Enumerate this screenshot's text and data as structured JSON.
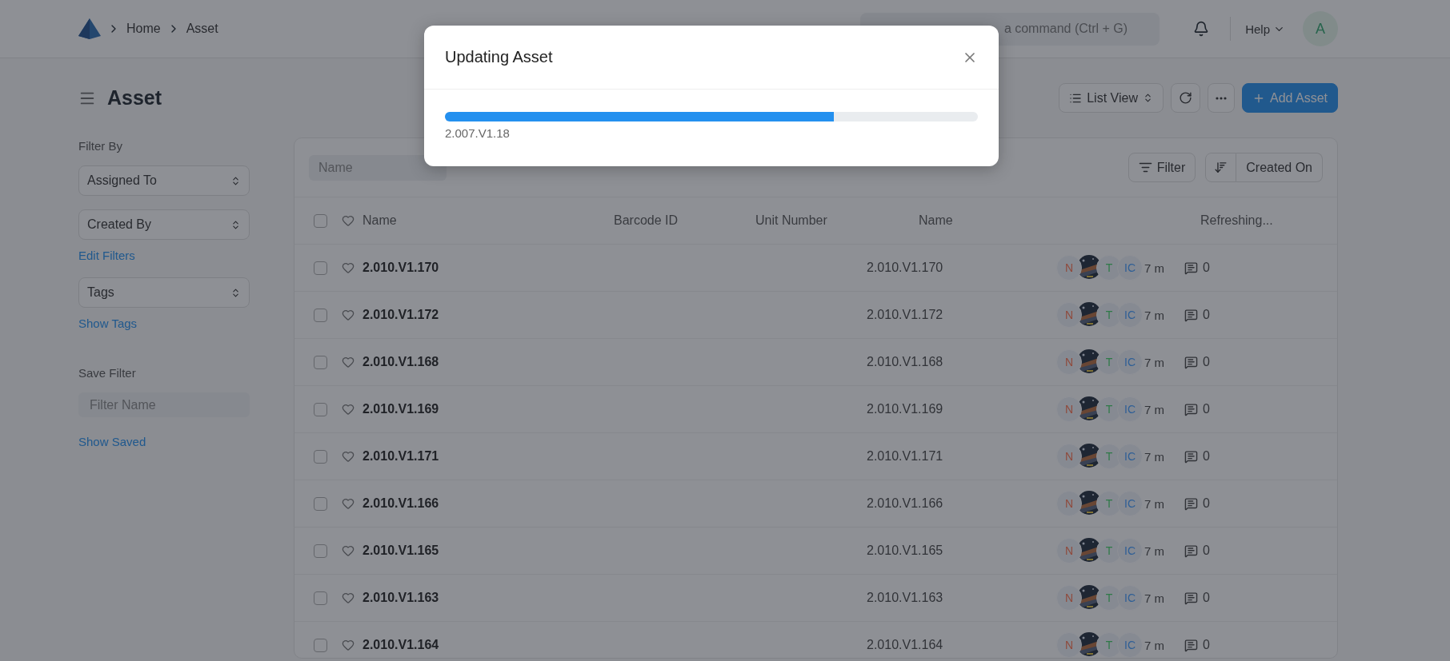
{
  "navbar": {
    "breadcrumbs": [
      "Home",
      "Asset"
    ],
    "search": {
      "placeholder": "a command (Ctrl + G)"
    },
    "help": "Help",
    "avatar": "A"
  },
  "page": {
    "title": "Asset",
    "view": "List View",
    "add": "Add Asset"
  },
  "sidebar": {
    "filter_heading": "Filter By",
    "filters": [
      "Assigned To",
      "Created By"
    ],
    "edit_link": "Edit Filters",
    "tags": "Tags",
    "tags_link": "Show Tags",
    "save_heading": "Save Filter",
    "save_field": {
      "placeholder": "Filter Name"
    },
    "saved_link": "Show Saved"
  },
  "filter_bar": {
    "name": {
      "placeholder": "Name"
    },
    "filter": "Filter",
    "sort": "Created On"
  },
  "table": {
    "select_all": {
      "checked": false
    },
    "columns": [
      "Name",
      "Barcode ID",
      "Unit Number",
      "Name",
      "Refreshing..."
    ],
    "rows": [
      {
        "checked": false,
        "name": "2.010.V1.170",
        "column_4": "2.010.V1.170",
        "assignees": [
          {
            "kind": "initials",
            "label": "N",
            "color": "#8f4a3c"
          },
          {
            "kind": "picture"
          },
          {
            "kind": "initials",
            "label": "T",
            "color": "#2f7a48"
          },
          {
            "kind": "initials",
            "label": "IC",
            "color": "#2f5f96"
          }
        ],
        "time": "7 m",
        "comments": "0"
      },
      {
        "checked": false,
        "name": "2.010.V1.172",
        "column_4": "2.010.V1.172",
        "assignees": [
          {
            "kind": "initials",
            "label": "N",
            "color": "#8f4a3c"
          },
          {
            "kind": "picture"
          },
          {
            "kind": "initials",
            "label": "T",
            "color": "#2f7a48"
          },
          {
            "kind": "initials",
            "label": "IC",
            "color": "#2f5f96"
          }
        ],
        "time": "7 m",
        "comments": "0"
      },
      {
        "checked": false,
        "name": "2.010.V1.168",
        "column_4": "2.010.V1.168",
        "assignees": [
          {
            "kind": "initials",
            "label": "N",
            "color": "#8f4a3c"
          },
          {
            "kind": "picture"
          },
          {
            "kind": "initials",
            "label": "T",
            "color": "#2f7a48"
          },
          {
            "kind": "initials",
            "label": "IC",
            "color": "#2f5f96"
          }
        ],
        "time": "7 m",
        "comments": "0"
      },
      {
        "checked": false,
        "name": "2.010.V1.169",
        "column_4": "2.010.V1.169",
        "assignees": [
          {
            "kind": "initials",
            "label": "N",
            "color": "#8f4a3c"
          },
          {
            "kind": "picture"
          },
          {
            "kind": "initials",
            "label": "T",
            "color": "#2f7a48"
          },
          {
            "kind": "initials",
            "label": "IC",
            "color": "#2f5f96"
          }
        ],
        "time": "7 m",
        "comments": "0"
      },
      {
        "checked": false,
        "name": "2.010.V1.171",
        "column_4": "2.010.V1.171",
        "assignees": [
          {
            "kind": "initials",
            "label": "N",
            "color": "#8f4a3c"
          },
          {
            "kind": "picture"
          },
          {
            "kind": "initials",
            "label": "T",
            "color": "#2f7a48"
          },
          {
            "kind": "initials",
            "label": "IC",
            "color": "#2f5f96"
          }
        ],
        "time": "7 m",
        "comments": "0"
      },
      {
        "checked": false,
        "name": "2.010.V1.166",
        "column_4": "2.010.V1.166",
        "assignees": [
          {
            "kind": "initials",
            "label": "N",
            "color": "#8f4a3c"
          },
          {
            "kind": "picture"
          },
          {
            "kind": "initials",
            "label": "T",
            "color": "#2f7a48"
          },
          {
            "kind": "initials",
            "label": "IC",
            "color": "#2f5f96"
          }
        ],
        "time": "7 m",
        "comments": "0"
      },
      {
        "checked": false,
        "name": "2.010.V1.165",
        "column_4": "2.010.V1.165",
        "assignees": [
          {
            "kind": "initials",
            "label": "N",
            "color": "#8f4a3c"
          },
          {
            "kind": "picture"
          },
          {
            "kind": "initials",
            "label": "T",
            "color": "#2f7a48"
          },
          {
            "kind": "initials",
            "label": "IC",
            "color": "#2f5f96"
          }
        ],
        "time": "7 m",
        "comments": "0"
      },
      {
        "checked": false,
        "name": "2.010.V1.163",
        "column_4": "2.010.V1.163",
        "assignees": [
          {
            "kind": "initials",
            "label": "N",
            "color": "#8f4a3c"
          },
          {
            "kind": "picture"
          },
          {
            "kind": "initials",
            "label": "T",
            "color": "#2f7a48"
          },
          {
            "kind": "initials",
            "label": "IC",
            "color": "#2f5f96"
          }
        ],
        "time": "7 m",
        "comments": "0"
      },
      {
        "checked": false,
        "name": "2.010.V1.164",
        "column_4": "2.010.V1.164",
        "assignees": [
          {
            "kind": "initials",
            "label": "N",
            "color": "#8f4a3c"
          },
          {
            "kind": "picture"
          },
          {
            "kind": "initials",
            "label": "T",
            "color": "#2f7a48"
          },
          {
            "kind": "initials",
            "label": "IC",
            "color": "#2f5f96"
          }
        ],
        "time": "7 m",
        "comments": "0"
      }
    ]
  },
  "modal": {
    "title": "Updating Asset",
    "level": 0.73,
    "caption": "2.007.V1.18"
  }
}
